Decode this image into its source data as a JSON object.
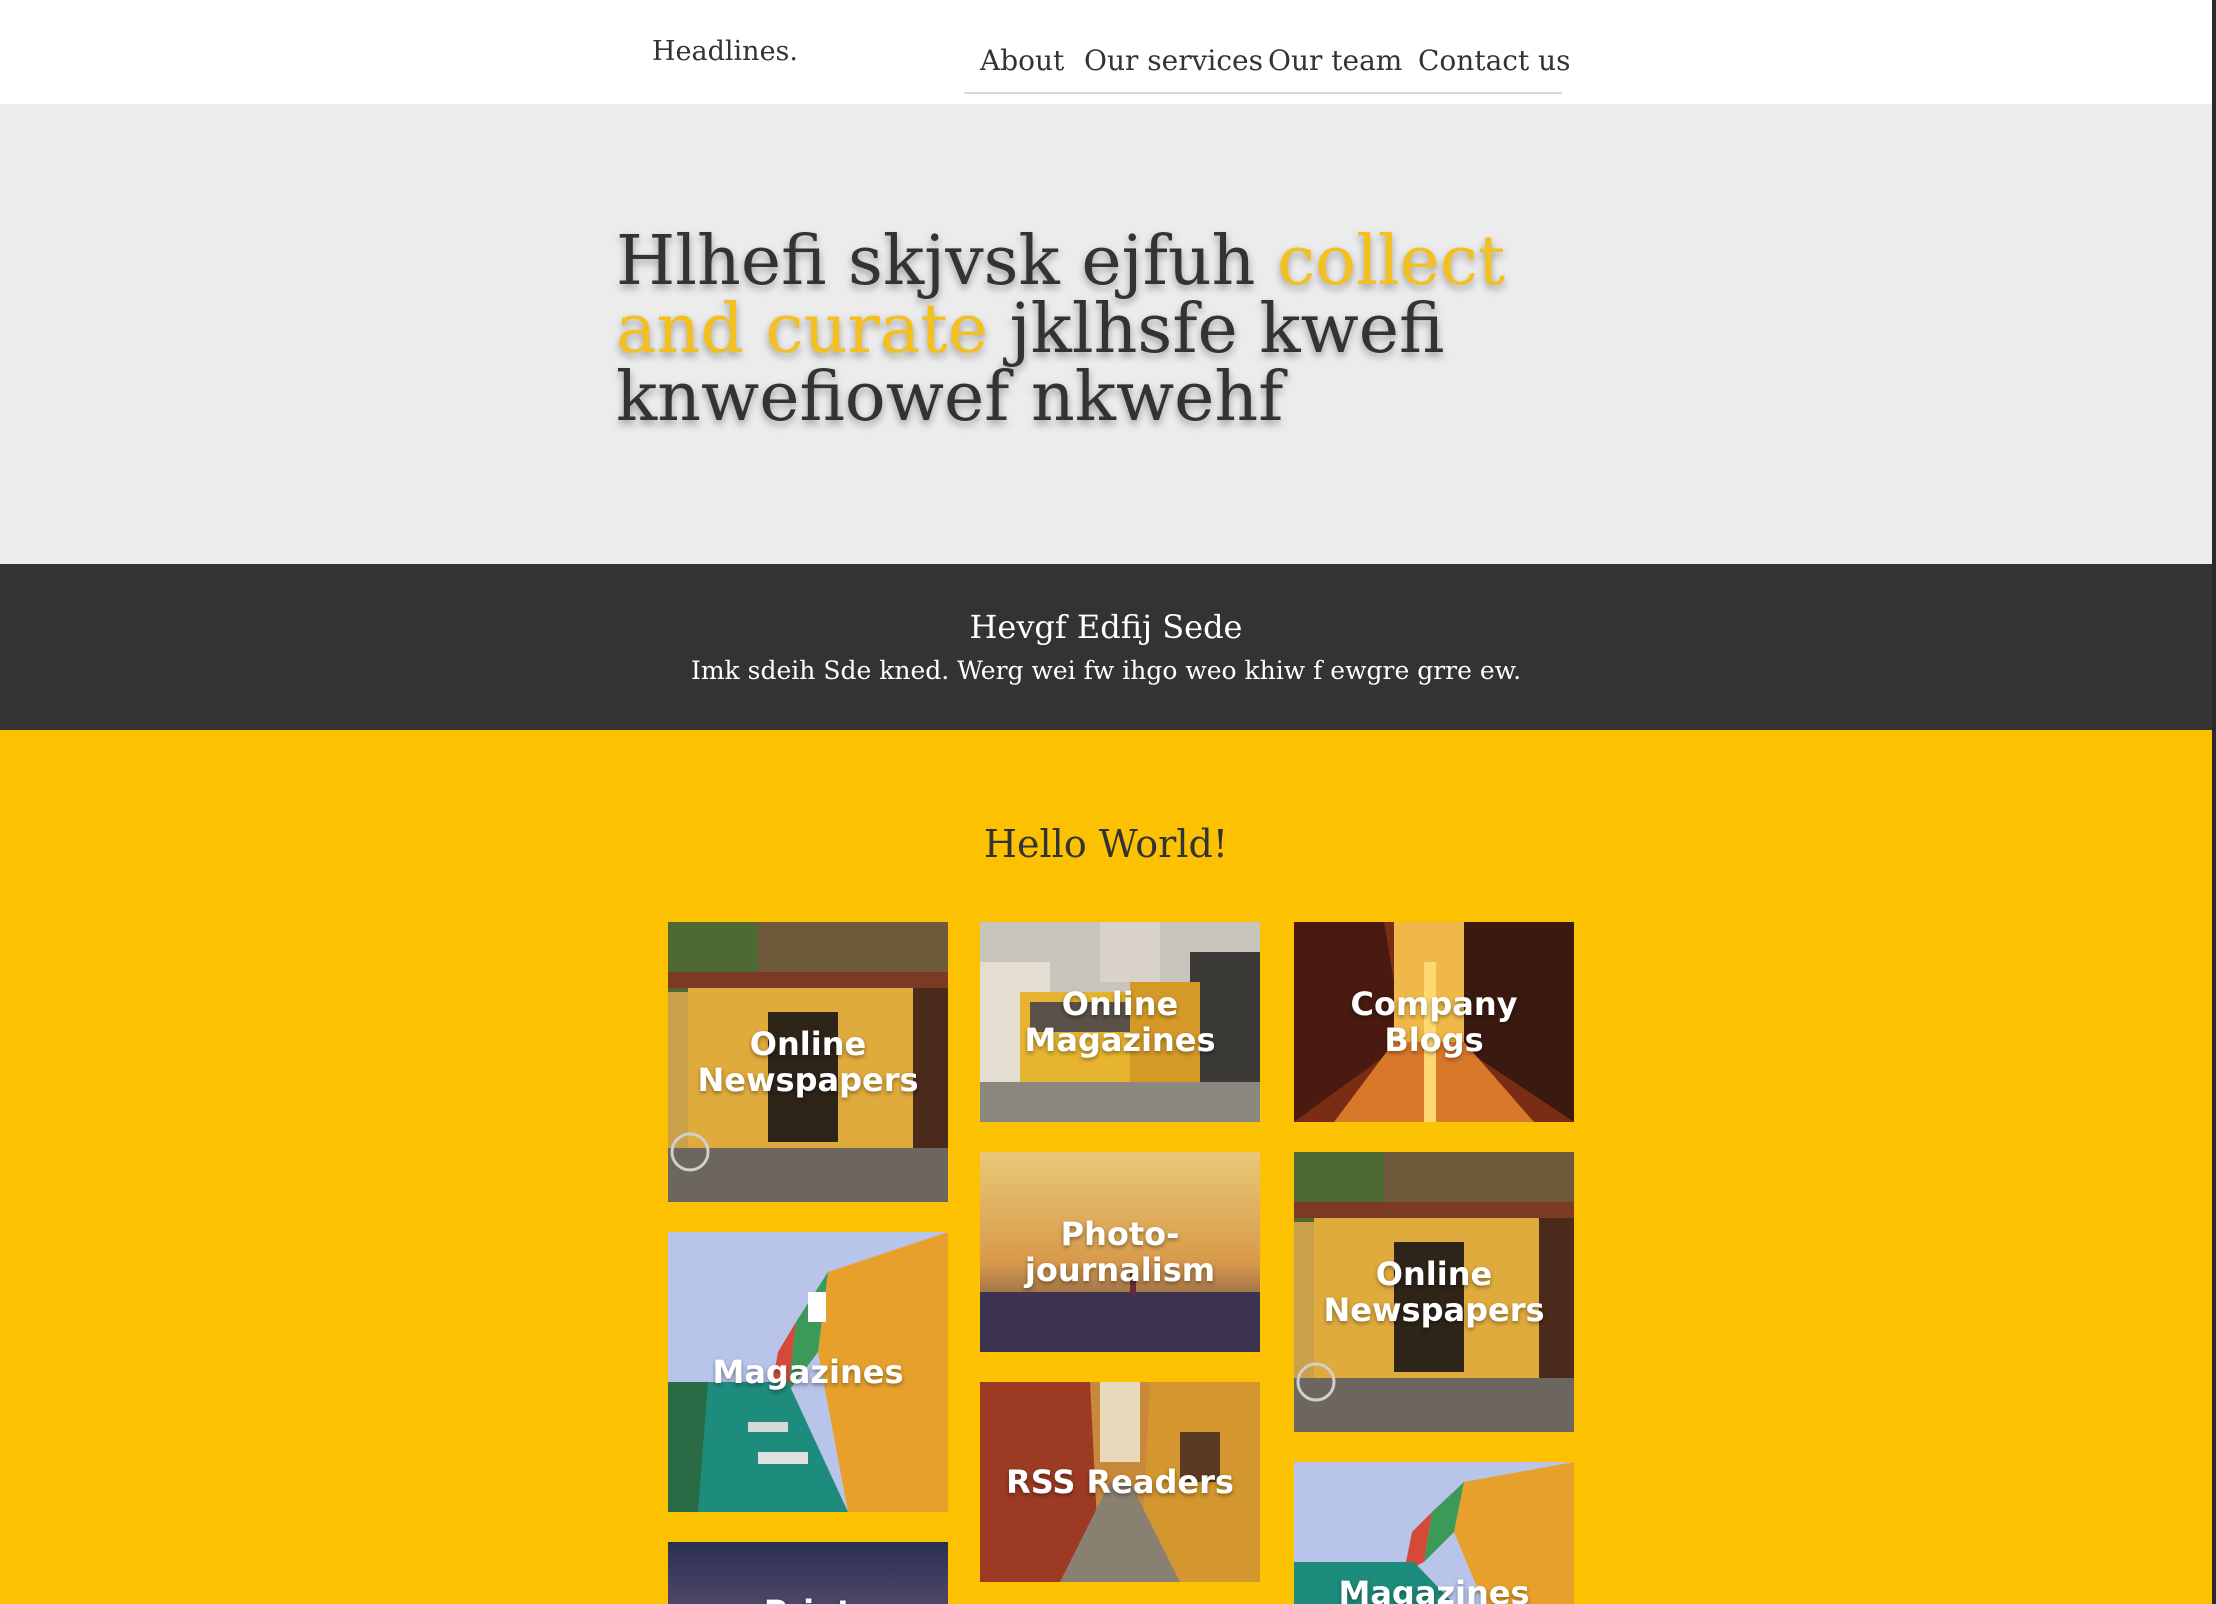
{
  "header": {
    "brand": "Headlines.",
    "nav": [
      "About",
      "Our services",
      "Our team",
      "Contact us"
    ]
  },
  "hero": {
    "text_before": "Hlhefi skjvsk ejfuh ",
    "highlight": "collect and curate",
    "text_after": " jklhsfe kwefi knwefiowef nkwehf",
    "highlight_color": "#f3c020"
  },
  "band": {
    "title": "Hevgf Edfij Sede",
    "subtitle": "Imk sdeih Sde kned. Werg wei fw ihgo weo khiw f ewgre grre ew."
  },
  "main": {
    "title": "Hello World!",
    "background": "#fcc202",
    "tiles": [
      {
        "label": "Online Newspapers",
        "image": "yellow-shopfront"
      },
      {
        "label": "Online Magazines",
        "image": "tram-street"
      },
      {
        "label": "Company Blogs",
        "image": "sunset-alley"
      },
      {
        "label": "Photo-journalism",
        "image": "hazy-field"
      },
      {
        "label": "Online Newspapers",
        "image": "yellow-shopfront"
      },
      {
        "label": "Magazines",
        "image": "canal-houses"
      },
      {
        "label": "RSS Readers",
        "image": "narrow-alley"
      },
      {
        "label": "Print",
        "image": "dusk-sky"
      },
      {
        "label": "Magazines",
        "image": "canal-houses"
      }
    ]
  }
}
